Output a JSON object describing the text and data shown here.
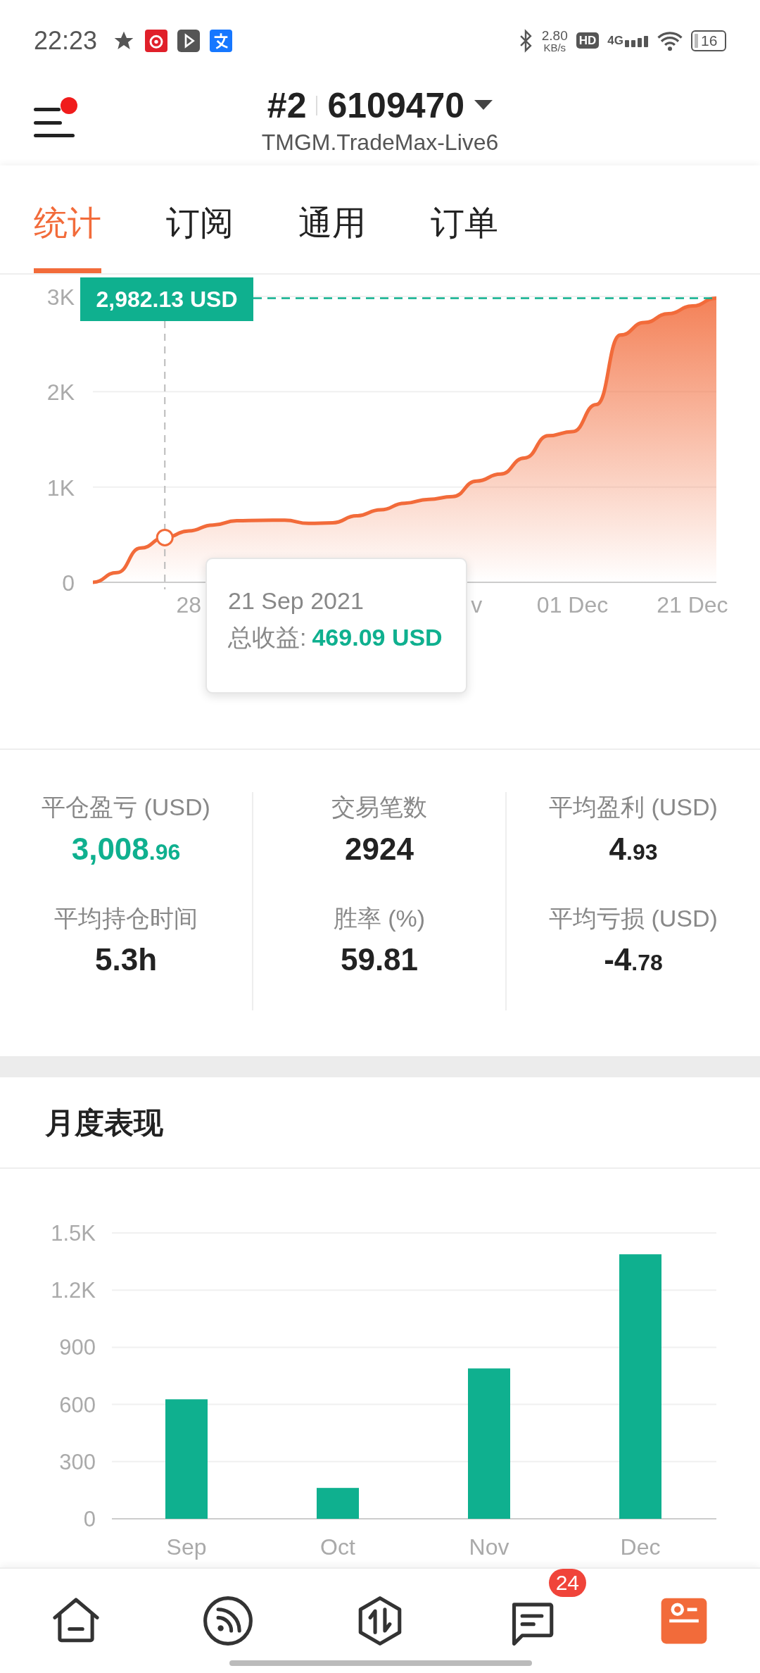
{
  "status_bar": {
    "time": "22:23",
    "net_speed": "2.80",
    "net_unit": "KB/s",
    "hd": "HD",
    "network": "4G",
    "battery": "16"
  },
  "header": {
    "account_index": "#2",
    "account_number": "6109470",
    "server": "TMGM.TradeMax-Live6",
    "menu_notification": true
  },
  "tabs": [
    {
      "label": "统计",
      "selected": true
    },
    {
      "label": "订阅",
      "selected": false
    },
    {
      "label": "通用",
      "selected": false
    },
    {
      "label": "订单",
      "selected": false
    }
  ],
  "equity_chart": {
    "crosshair_label": "2,982.13 USD",
    "tooltip": {
      "date": "21 Sep 2021",
      "label": "总收益:",
      "value": "469.09 USD"
    },
    "chart_data": {
      "type": "area",
      "grid": true,
      "categories": [
        null,
        null,
        null,
        null,
        "28",
        null,
        null,
        null,
        null,
        null,
        null,
        null,
        null,
        null,
        null,
        null,
        "v",
        null,
        null,
        null,
        "01 Dec",
        null,
        null,
        null,
        null,
        "21 Dec",
        null
      ],
      "series": [
        {
          "color": "#f26b3a",
          "values": [
            0,
            102,
            360,
            470,
            539,
            601,
            647,
            651,
            652,
            618,
            625,
            698,
            761,
            830,
            870,
            900,
            1062,
            1136,
            1305,
            1539,
            1582,
            1866,
            2595,
            2726,
            2819,
            2900,
            2982
          ]
        }
      ],
      "ylim": [
        0,
        3000
      ],
      "yticks": [
        {
          "value": 0,
          "label": "0"
        },
        {
          "value": 1000,
          "label": "1K"
        },
        {
          "value": 2000,
          "label": "2K"
        },
        {
          "value": 3000,
          "label": "3K"
        }
      ]
    }
  },
  "stats": [
    {
      "label": "平仓盈亏 (USD)",
      "value": "3,008",
      "fraction": ".96",
      "highlight": true
    },
    {
      "label": "交易笔数",
      "value": "2924",
      "highlight": false
    },
    {
      "label": "平均盈利 (USD)",
      "value": "4",
      "fraction": ".93",
      "highlight": false
    },
    {
      "label": "平均持仓时间",
      "value": "5.3h",
      "highlight": false
    },
    {
      "label": "胜率 (%)",
      "value": "59.81",
      "highlight": false
    },
    {
      "label": "平均亏损 (USD)",
      "value": "-4",
      "fraction": ".78",
      "highlight": false
    }
  ],
  "monthly": {
    "title": "月度表现",
    "chart_data": {
      "type": "bar",
      "grid": true,
      "categories": [
        "Sep",
        "Oct",
        "Nov",
        "Dec"
      ],
      "series": [
        {
          "color": "#0fb08f",
          "values": [
            627,
            162,
            789,
            1388
          ]
        }
      ],
      "ylim": [
        0,
        1500
      ],
      "yticks": [
        {
          "value": 0,
          "label": "0"
        },
        {
          "value": 300,
          "label": "300"
        },
        {
          "value": 600,
          "label": "600"
        },
        {
          "value": 900,
          "label": "900"
        },
        {
          "value": 1200,
          "label": "1.2K"
        },
        {
          "value": 1500,
          "label": "1.5K"
        }
      ]
    }
  },
  "bottom_nav": [
    {
      "kind": "home"
    },
    {
      "kind": "feed"
    },
    {
      "kind": "trade"
    },
    {
      "kind": "messages",
      "badge": "24"
    },
    {
      "kind": "profile"
    }
  ]
}
